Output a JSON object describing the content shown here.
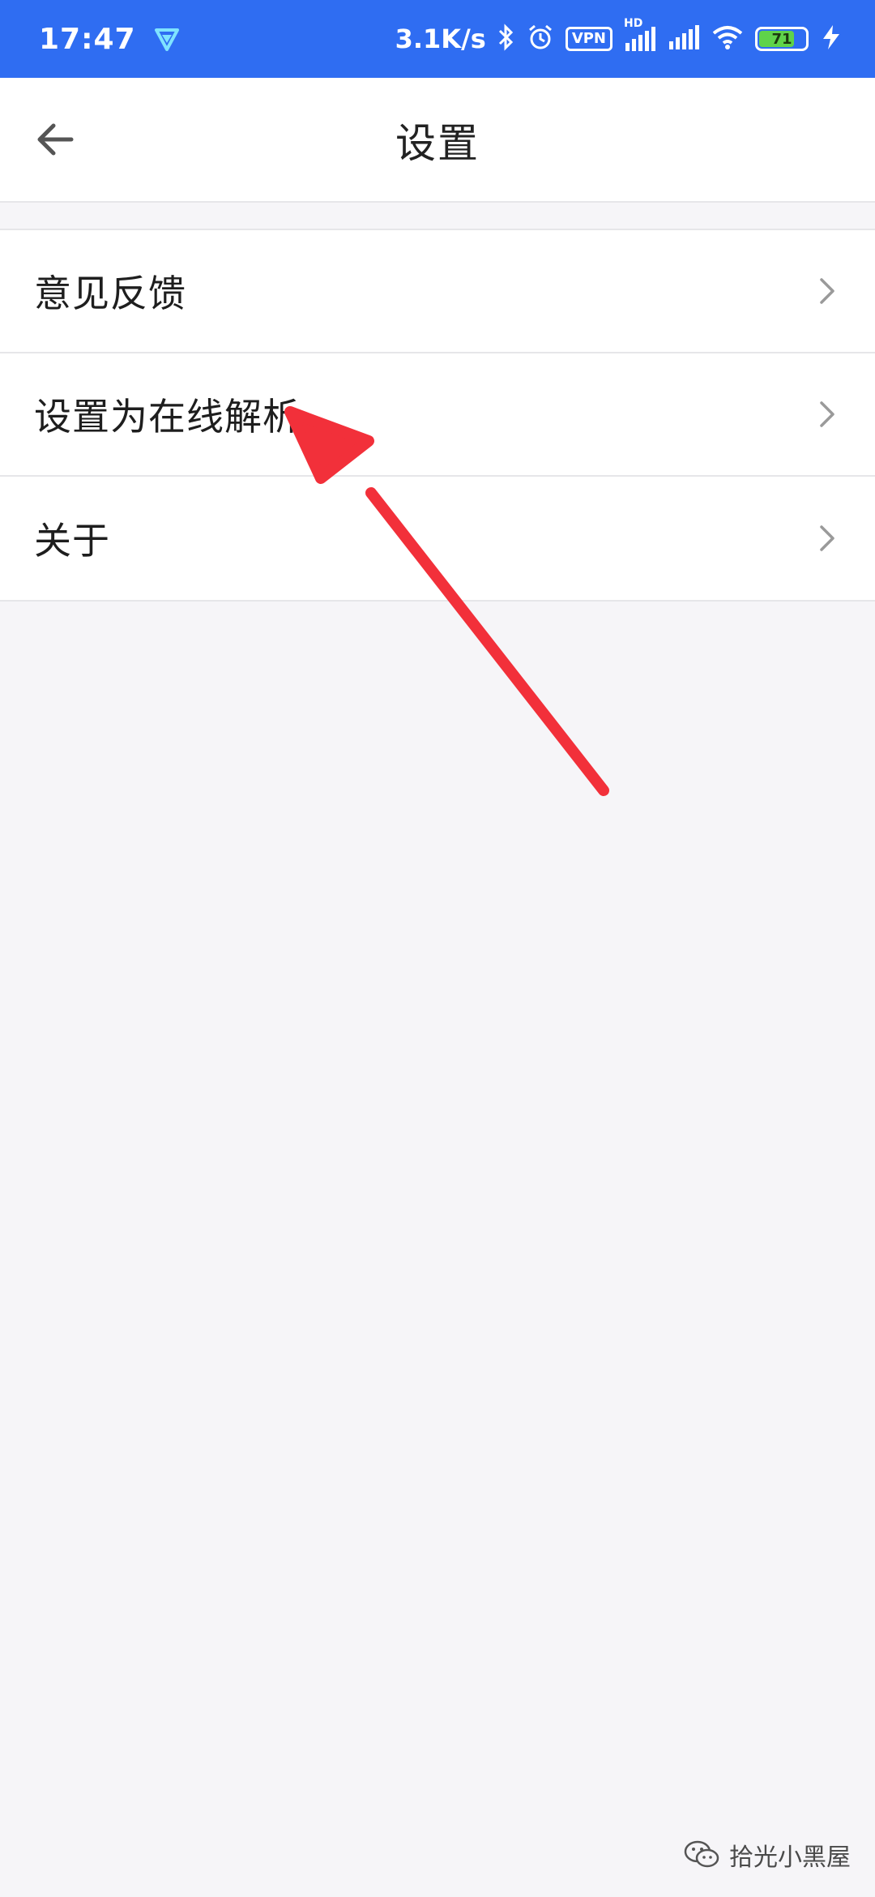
{
  "status_bar": {
    "time": "17:47",
    "net_speed": "3.1K/s",
    "vpn": "VPN",
    "hd": "HD",
    "battery_level": "71",
    "icons": [
      "app-shield-icon",
      "bluetooth-icon",
      "alarm-icon",
      "signal-icon",
      "wifi-icon",
      "battery-icon",
      "charging-icon"
    ]
  },
  "header": {
    "title": "设置",
    "back_icon": "arrow-left-icon"
  },
  "menu": {
    "items": [
      {
        "label": "意见反馈",
        "icon": "chevron-right-icon"
      },
      {
        "label": "设置为在线解析",
        "icon": "chevron-right-icon"
      },
      {
        "label": "关于",
        "icon": "chevron-right-icon"
      }
    ]
  },
  "annotation": {
    "color": "#f2303a",
    "target": "设置为在线解析"
  },
  "watermark": {
    "text": "拾光小黑屋",
    "icon": "wechat-icon"
  },
  "colors": {
    "status_bar": "#2f6df2",
    "background": "#f6f5f8",
    "surface": "#ffffff"
  }
}
